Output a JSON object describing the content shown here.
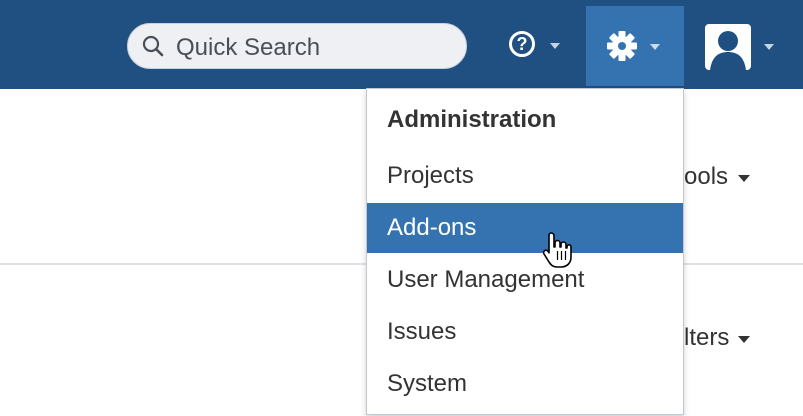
{
  "header": {
    "search": {
      "placeholder": "Quick Search",
      "icon": "search-icon"
    },
    "help": {
      "icon": "help-icon",
      "symbol": "?"
    },
    "settings": {
      "icon": "gear-icon",
      "active_color": "#3572b0"
    },
    "profile": {
      "icon": "user-avatar-icon"
    },
    "bg_color": "#205081"
  },
  "page": {
    "tools_label": "ools",
    "filters_label": "lters"
  },
  "menu": {
    "heading": "Administration",
    "items": [
      {
        "label": "Projects"
      },
      {
        "label": "Add-ons",
        "selected": true
      },
      {
        "label": "User Management"
      },
      {
        "label": "Issues"
      },
      {
        "label": "System"
      }
    ],
    "selected_color": "#3572b0"
  },
  "cursor": {
    "icon": "hand-pointer-icon"
  }
}
